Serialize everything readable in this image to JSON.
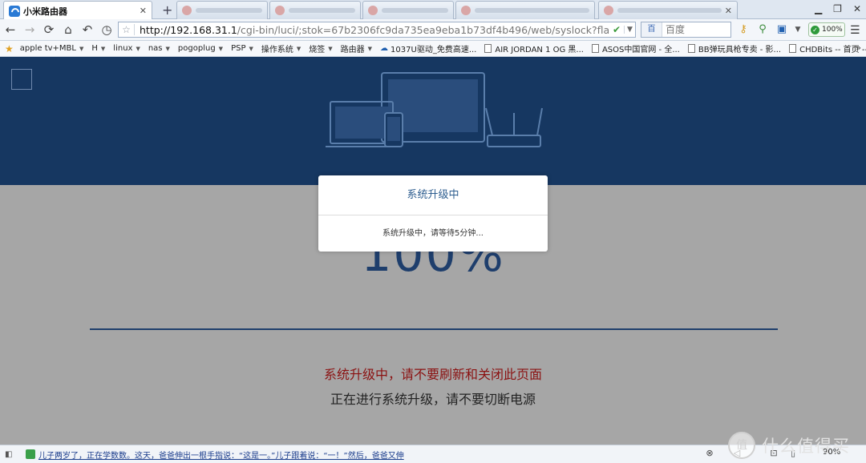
{
  "tabs": [
    {
      "title": "小米路由器",
      "close": "✕",
      "active": true
    },
    {
      "title": "",
      "close": "✕",
      "active": false
    },
    {
      "title": "",
      "close": "✕",
      "active": false
    },
    {
      "title": "",
      "close": "✕",
      "active": false
    },
    {
      "title": "",
      "close": "✕",
      "active": false
    },
    {
      "title": "",
      "close": "✕",
      "active": false
    }
  ],
  "new_tab": "+",
  "window_controls": {
    "minimize": "▁",
    "maximize": "❐",
    "close": "✕"
  },
  "nav": {
    "back": "←",
    "forward": "→",
    "refresh": "⟳",
    "home": "⌂",
    "undo": "↶",
    "history": "◷",
    "url_host": "http://192.168.31.1",
    "url_path": "/cgi-bin/luci/;stok=67b2306fc9da735ea9eba1b73df4b496/web/syslock?flashtype=download",
    "search_engine": "百",
    "search_placeholder": "百度",
    "zoom_badge": "100%"
  },
  "bookmarks": [
    {
      "label": "apple tv+MBL",
      "folder": true
    },
    {
      "label": "H",
      "folder": true
    },
    {
      "label": "linux",
      "folder": true
    },
    {
      "label": "nas",
      "folder": true
    },
    {
      "label": "pogoplug",
      "folder": true
    },
    {
      "label": "PSP",
      "folder": true
    },
    {
      "label": "操作系统",
      "folder": true
    },
    {
      "label": "烧签",
      "folder": true
    },
    {
      "label": "路由器",
      "folder": true
    },
    {
      "label": "1037U驱动_免费高速...",
      "folder": false
    },
    {
      "label": "AIR JORDAN 1 OG 黑...",
      "folder": false
    },
    {
      "label": "ASOS中国官网 - 全...",
      "folder": false
    },
    {
      "label": "BB弹玩具枪专卖 - 影...",
      "folder": false
    },
    {
      "label": "CHDBits -- 首页 -- C...",
      "folder": false
    }
  ],
  "bookmarks_more": "»",
  "page": {
    "percent": "100%",
    "warning_red": "系统升级中，请不要刷新和关闭此页面",
    "warning_black": "正在进行系统升级，请不要切断电源"
  },
  "modal": {
    "title": "系统升级中",
    "message": "系统升级中，请等待5分钟..."
  },
  "status": {
    "news": "儿子两岁了，正在学数数。这天，爸爸伸出一根手指说：“这是一。”儿子跟着说：“一！”然后，爸爸又伸",
    "zoom": "90%"
  },
  "watermark": {
    "icon_text": "值",
    "text": "什么值得买"
  },
  "colors": {
    "hero": "#163761",
    "accent": "#1e3e6c",
    "warning": "#8b1212",
    "overlay": "#a6a6a6"
  }
}
